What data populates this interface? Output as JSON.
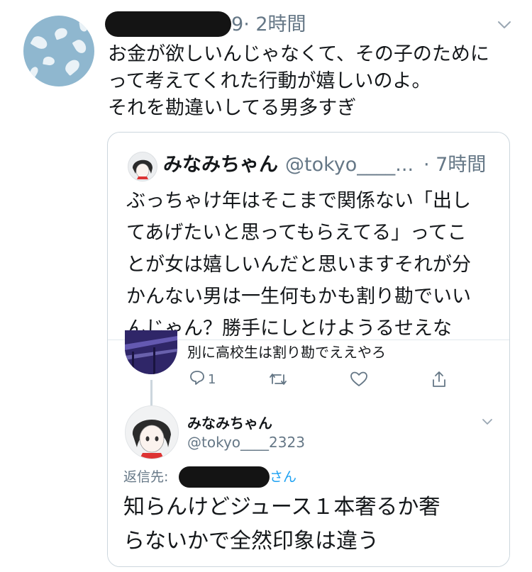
{
  "tweet": {
    "handle_visible_tail": "9",
    "time": "· 2時間",
    "text_lines": [
      "お金が欲しいんじゃなくて、その子のために",
      "って考えてくれた行動が嬉しいのよ。",
      "それを勘違いしてる男多すぎ"
    ],
    "avatar_icon": "avatar-petals"
  },
  "quote": {
    "name": "みなみちゃん",
    "handle": "@tokyo____...",
    "time": "· 7時間",
    "text_lines": [
      "ぶっちゃけ年はそこまで関係ない「出し",
      "てあげたいと思ってもらえてる」ってこ",
      "とが女は嬉しいんだと思いますそれが分",
      "かんない男は一生何もかも割り勘でいい",
      "んじゃん？勝手にしとけようるせえな"
    ]
  },
  "screenshot": {
    "parent_reply_text": "別に高校生は割り勘でええやろ",
    "actions": {
      "reply_count": "1",
      "retweet_icon": "retweet-icon",
      "like_icon": "heart-icon",
      "share_icon": "share-icon"
    },
    "reply": {
      "name": "みなみちゃん",
      "handle": "@tokyo____2323",
      "reply_to_label": "返信先:",
      "reply_to_suffix": "さん",
      "text_lines": [
        "知らんけどジュース１本奢るか奢",
        "らないかで全然印象は違う"
      ]
    }
  },
  "colors": {
    "text": "#14171a",
    "secondary": "#657786",
    "border": "#ccd6dd",
    "link": "#1da1f2",
    "redaction": "#141414"
  }
}
